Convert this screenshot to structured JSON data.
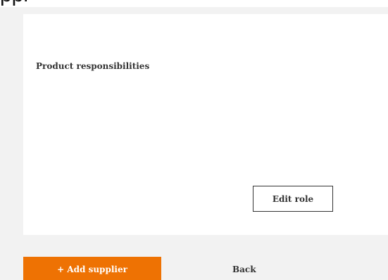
{
  "header": {
    "title_fragment": "ppl"
  },
  "card": {
    "section_label": "Product responsibilities",
    "edit_role_label": "Edit role"
  },
  "actions": {
    "add_supplier_label": "+ Add supplier",
    "back_label": "Back"
  },
  "colors": {
    "accent": "#ee7203",
    "band_background": "#f2f2f2",
    "text": "#333333"
  }
}
